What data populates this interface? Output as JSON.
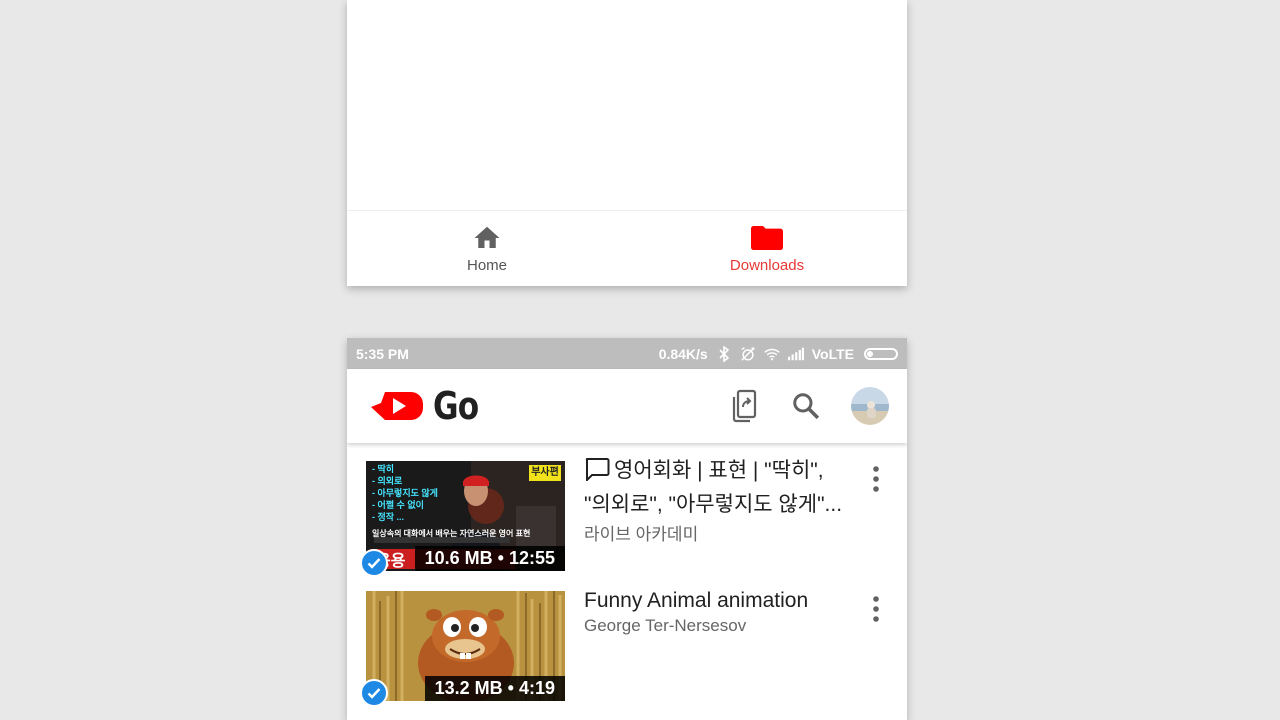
{
  "top_nav": {
    "items": [
      {
        "label": "Home",
        "icon": "home-icon",
        "active": false
      },
      {
        "label": "Downloads",
        "icon": "folder-icon",
        "active": true
      }
    ]
  },
  "status_bar": {
    "time": "5:35 PM",
    "speed": "0.84K/s",
    "network": "VoLTE"
  },
  "app_bar": {
    "logo_text": "Go",
    "actions": [
      "share-phone-icon",
      "search-icon",
      "avatar"
    ]
  },
  "videos": [
    {
      "title": "영어회화 | 표현 | \"딱히\", \"의외로\", \"아무렇지도 않게\"...",
      "title_line1": "영어회화 | 표현 | \"딱히\",",
      "title_line2": "\"의외로\", \"아무렇지도 않게\"...",
      "channel": "라이브 아카데미",
      "badge": "10.6 MB • 12:55",
      "thumb_tag": "부사편",
      "thumb_lines": [
        "- 딱히",
        "- 의외로",
        "- 아무렇지도 않게",
        "- 어쩔 수 없이",
        "- 정작 ..."
      ],
      "thumb_caption": "일상속의 대화에서 배우는 자연스러운 영어 표현",
      "thumb_big": "응용"
    },
    {
      "title": "Funny Animal animation",
      "channel": "George Ter-Nersesov",
      "badge": "13.2 MB • 4:19"
    }
  ],
  "colors": {
    "accent": "#ff0000",
    "active_label": "#e53935",
    "check": "#1e88e5",
    "status_bar": "#bdbdbd"
  }
}
